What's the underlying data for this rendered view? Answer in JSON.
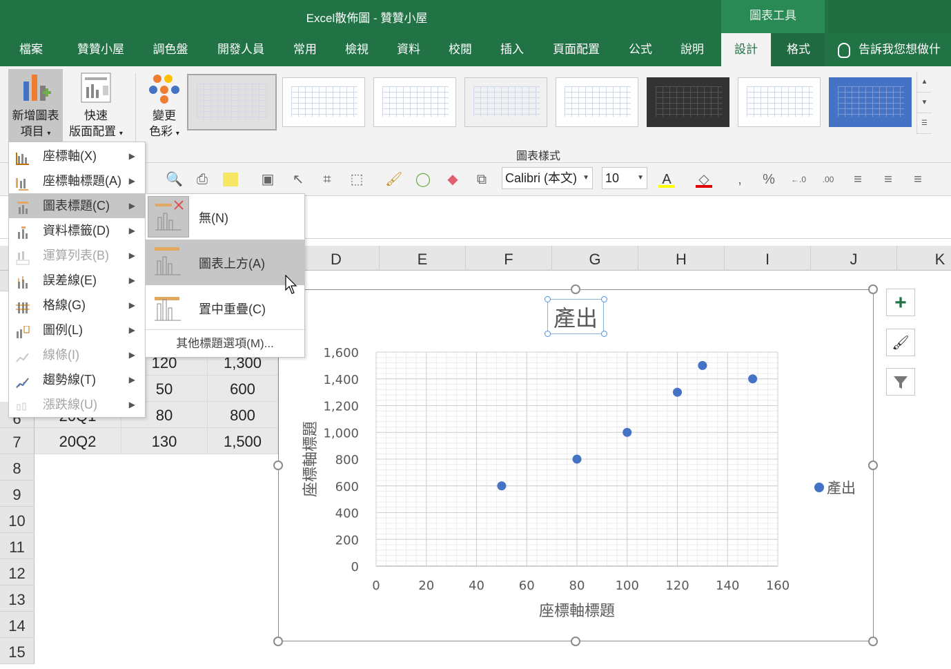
{
  "window": {
    "title": "Excel散佈圖  -  贊贊小屋",
    "context_tools": "圖表工具"
  },
  "tabs": [
    {
      "label": "檔案"
    },
    {
      "label": "贊贊小屋"
    },
    {
      "label": "調色盤"
    },
    {
      "label": "開發人員"
    },
    {
      "label": "常用"
    },
    {
      "label": "檢視"
    },
    {
      "label": "資料"
    },
    {
      "label": "校閱"
    },
    {
      "label": "插入"
    },
    {
      "label": "頁面配置"
    },
    {
      "label": "公式"
    },
    {
      "label": "說明"
    },
    {
      "label": "設計"
    },
    {
      "label": "格式"
    }
  ],
  "tell_me": "告訴我您想做什",
  "ribbon": {
    "add_element": {
      "line1": "新增圖表",
      "line2": "項目"
    },
    "quick_layout": {
      "line1": "快速",
      "line2": "版面配置"
    },
    "change_colors": {
      "line1": "變更",
      "line2": "色彩"
    },
    "group_label": "圖表樣式"
  },
  "format_bar": {
    "font": "Calibri (本文)",
    "size": "10"
  },
  "columns": [
    "D",
    "E",
    "F",
    "G",
    "H",
    "I",
    "J",
    "K"
  ],
  "rows": [
    "7",
    "8",
    "9",
    "10",
    "11",
    "12",
    "13",
    "14",
    "15"
  ],
  "row6_partial": "6",
  "cells": {
    "r4": {
      "b": "120",
      "c": "1,300"
    },
    "r5": {
      "b": "50",
      "c": "600"
    },
    "r6": {
      "a": "20Q1",
      "b": "80",
      "c": "800"
    },
    "r7": {
      "a": "20Q2",
      "b": "130",
      "c": "1,500"
    }
  },
  "menu": {
    "items": [
      {
        "label": "座標軸(X)",
        "enabled": true
      },
      {
        "label": "座標軸標題(A)",
        "enabled": true
      },
      {
        "label": "圖表標題(C)",
        "enabled": true
      },
      {
        "label": "資料標籤(D)",
        "enabled": true
      },
      {
        "label": "運算列表(B)",
        "enabled": false
      },
      {
        "label": "誤差線(E)",
        "enabled": true
      },
      {
        "label": "格線(G)",
        "enabled": true
      },
      {
        "label": "圖例(L)",
        "enabled": true
      },
      {
        "label": "線條(I)",
        "enabled": false
      },
      {
        "label": "趨勢線(T)",
        "enabled": true
      },
      {
        "label": "漲跌線(U)",
        "enabled": false
      }
    ],
    "submenu": {
      "items": [
        {
          "label": "無(N)"
        },
        {
          "label": "圖表上方(A)"
        },
        {
          "label": "置中重疊(C)"
        }
      ],
      "more": "其他標題選項(M)..."
    }
  },
  "chart_data": {
    "type": "scatter",
    "title": "產出",
    "xlabel": "座標軸標題",
    "ylabel": "座標軸標題",
    "xlim": [
      0,
      160
    ],
    "ylim": [
      0,
      1600
    ],
    "x_ticks": [
      "0",
      "20",
      "40",
      "60",
      "80",
      "100",
      "120",
      "140",
      "160"
    ],
    "y_ticks": [
      "0",
      "200",
      "400",
      "600",
      "800",
      "1,000",
      "1,200",
      "1,400",
      "1,600"
    ],
    "grid": true,
    "legend": "right",
    "series": [
      {
        "name": "產出",
        "color": "#4472c4",
        "points": [
          [
            50,
            600
          ],
          [
            80,
            800
          ],
          [
            100,
            1000
          ],
          [
            120,
            1300
          ],
          [
            130,
            1500
          ],
          [
            150,
            1400
          ]
        ]
      }
    ]
  }
}
